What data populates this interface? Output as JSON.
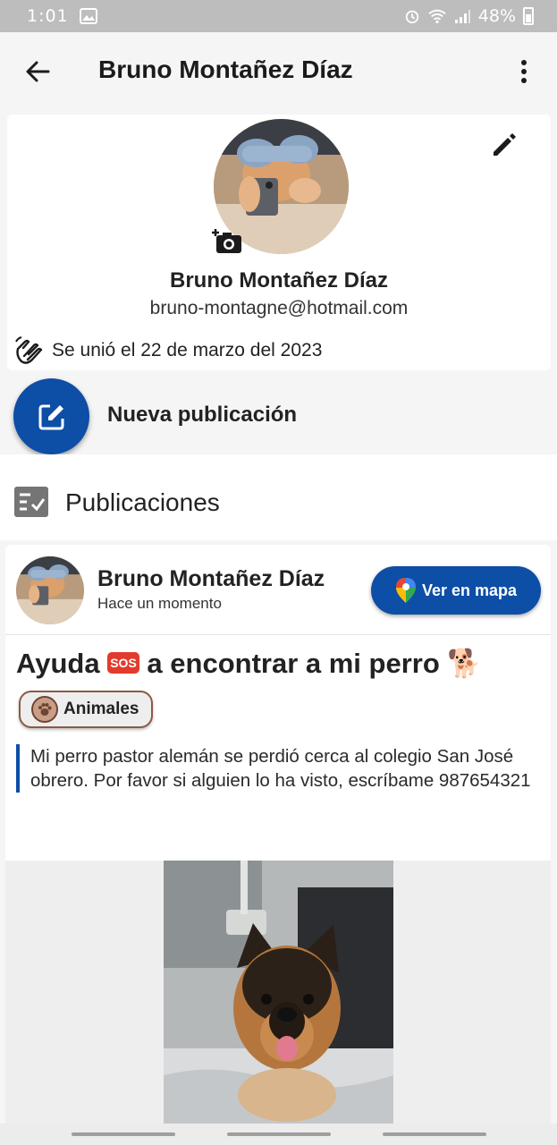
{
  "status_bar": {
    "time": "1:01",
    "battery": "48%"
  },
  "app_bar": {
    "title": "Bruno Montañez Díaz"
  },
  "profile": {
    "name": "Bruno Montañez Díaz",
    "email": "bruno-montagne@hotmail.com",
    "joined": "Se unió el 22 de marzo del 2023"
  },
  "new_post": {
    "label": "Nueva publicación"
  },
  "publications": {
    "label": "Publicaciones"
  },
  "post": {
    "author": "Bruno Montañez Díaz",
    "time": "Hace un momento",
    "map_button": "Ver en mapa",
    "title_part1": "Ayuda",
    "sos_badge": "SOS",
    "title_part2": "a encontrar a mi perro",
    "title_emoji": "🐕",
    "category": "Animales",
    "description": "Mi perro pastor alemán se perdió cerca al colegio San José obrero. Por favor si alguien lo ha visto, escríbame 987654321"
  },
  "colors": {
    "primary": "#0d4ea6",
    "chip_border": "#8c5a45",
    "sos": "#e23b2e"
  }
}
